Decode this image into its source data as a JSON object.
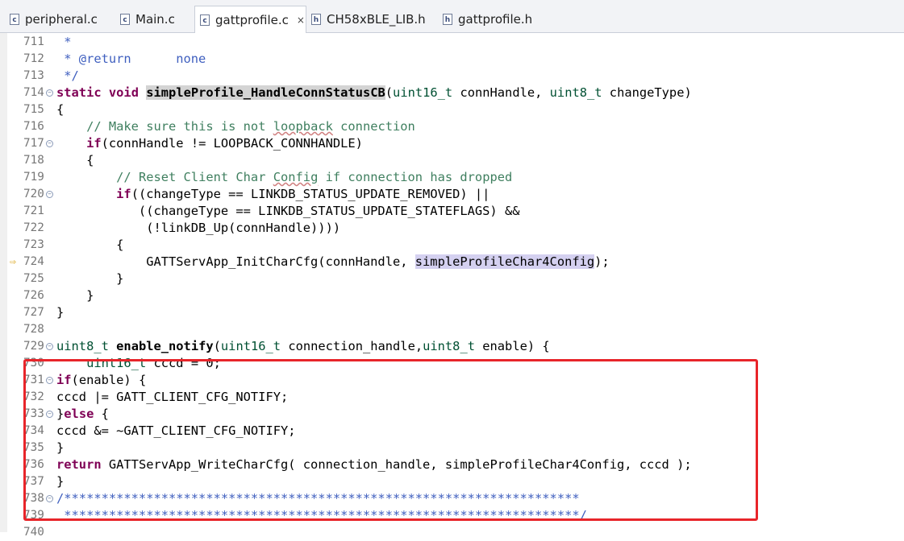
{
  "tabs": [
    {
      "label": "peripheral.c",
      "icon": "c-file-icon",
      "active": false
    },
    {
      "label": "Main.c",
      "icon": "c-file-icon",
      "active": false
    },
    {
      "label": "gattprofile.c",
      "icon": "c-file-icon",
      "active": true
    },
    {
      "label": "CH58xBLE_LIB.h",
      "icon": "h-file-icon",
      "active": false
    },
    {
      "label": "gattprofile.h",
      "icon": "h-file-icon",
      "active": false
    }
  ],
  "tab_close_glyph": "×",
  "debug_marker_line": "724",
  "highlight_color": "#e8252a",
  "lines": [
    {
      "n": "711",
      "text": " *"
    },
    {
      "n": "712",
      "text": " * @return      none"
    },
    {
      "n": "713",
      "text": " */"
    },
    {
      "n": "714",
      "text": "static void simpleProfile_HandleConnStatusCB(uint16_t connHandle, uint8_t changeType)"
    },
    {
      "n": "715",
      "text": "{"
    },
    {
      "n": "716",
      "text": "    // Make sure this is not loopback connection"
    },
    {
      "n": "717",
      "text": "    if(connHandle != LOOPBACK_CONNHANDLE)"
    },
    {
      "n": "718",
      "text": "    {"
    },
    {
      "n": "719",
      "text": "        // Reset Client Char Config if connection has dropped"
    },
    {
      "n": "720",
      "text": "        if((changeType == LINKDB_STATUS_UPDATE_REMOVED) ||"
    },
    {
      "n": "721",
      "text": "           ((changeType == LINKDB_STATUS_UPDATE_STATEFLAGS) &&"
    },
    {
      "n": "722",
      "text": "            (!linkDB_Up(connHandle))))"
    },
    {
      "n": "723",
      "text": "        {"
    },
    {
      "n": "724",
      "text": "            GATTServApp_InitCharCfg(connHandle, simpleProfileChar4Config);"
    },
    {
      "n": "725",
      "text": "        }"
    },
    {
      "n": "726",
      "text": "    }"
    },
    {
      "n": "727",
      "text": "}"
    },
    {
      "n": "728",
      "text": ""
    },
    {
      "n": "729",
      "text": "uint8_t enable_notify(uint16_t connection_handle,uint8_t enable) {"
    },
    {
      "n": "730",
      "text": "    uint16_t cccd = 0;"
    },
    {
      "n": "731",
      "text": "if(enable) {"
    },
    {
      "n": "732",
      "text": "cccd |= GATT_CLIENT_CFG_NOTIFY;"
    },
    {
      "n": "733",
      "text": "}else {"
    },
    {
      "n": "734",
      "text": "cccd &= ~GATT_CLIENT_CFG_NOTIFY;"
    },
    {
      "n": "735",
      "text": "}"
    },
    {
      "n": "736",
      "text": "return GATTServApp_WriteCharCfg( connection_handle, simpleProfileChar4Config, cccd );"
    },
    {
      "n": "737",
      "text": "}"
    },
    {
      "n": "738",
      "text": "/*********************************************************************"
    },
    {
      "n": "739",
      "text": " *********************************************************************/"
    },
    {
      "n": "740",
      "text": ""
    }
  ]
}
